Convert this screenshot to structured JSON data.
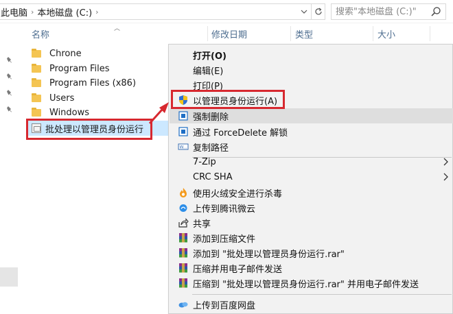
{
  "address": {
    "crumbs": [
      "此电脑",
      "本地磁盘 (C:)"
    ],
    "search_placeholder": "搜索\"本地磁盘 (C:)\""
  },
  "columns": {
    "name": "名称",
    "modified": "修改日期",
    "type": "类型",
    "size": "大小"
  },
  "files": [
    {
      "name": "Chrone",
      "kind": "folder"
    },
    {
      "name": "Program Files",
      "kind": "folder"
    },
    {
      "name": "Program Files (x86)",
      "kind": "folder"
    },
    {
      "name": "Users",
      "kind": "folder"
    },
    {
      "name": "Windows",
      "kind": "folder"
    }
  ],
  "selected_file": {
    "name": "批处理以管理员身份运行",
    "icon": "batch-file-icon"
  },
  "context_menu": {
    "items": [
      {
        "label": "打开(O)",
        "bold": true,
        "icon": ""
      },
      {
        "label": "编辑(E)",
        "icon": ""
      },
      {
        "label": "打印(P)",
        "icon": ""
      },
      {
        "label": "以管理员身份运行(A)",
        "icon": "uac-shield-icon"
      },
      {
        "label": "强制删除",
        "icon": "force-delete-icon"
      },
      {
        "label": "通过 ForceDelete 解锁",
        "icon": "force-delete-icon"
      },
      {
        "label": "复制路径",
        "icon": "copy-path-icon"
      },
      {
        "label": "7-Zip",
        "icon": "",
        "submenu": true
      },
      {
        "label": "CRC SHA",
        "icon": "",
        "submenu": true
      },
      {
        "label": "使用火绒安全进行杀毒",
        "icon": "huorong-icon"
      },
      {
        "label": "上传到腾讯微云",
        "icon": "weiyun-icon"
      },
      {
        "label": "共享",
        "icon": "share-icon"
      },
      {
        "label": "添加到压缩文件",
        "icon": "winrar-icon"
      },
      {
        "label": "添加到 \"批处理以管理员身份运行.rar\"",
        "icon": "winrar-icon"
      },
      {
        "label": "压缩并用电子邮件发送",
        "icon": "winrar-icon"
      },
      {
        "label": "压缩到 \"批处理以管理员身份运行.rar\" 并用电子邮件发送",
        "icon": "winrar-icon"
      },
      {
        "label": "上传到百度网盘",
        "icon": "baidu-netdisk-icon"
      }
    ]
  },
  "colors": {
    "highlight_red": "#d7282f",
    "selection_blue": "#cce8ff",
    "menu_bg": "#f2f2f2",
    "menu_hover": "#dedede"
  }
}
